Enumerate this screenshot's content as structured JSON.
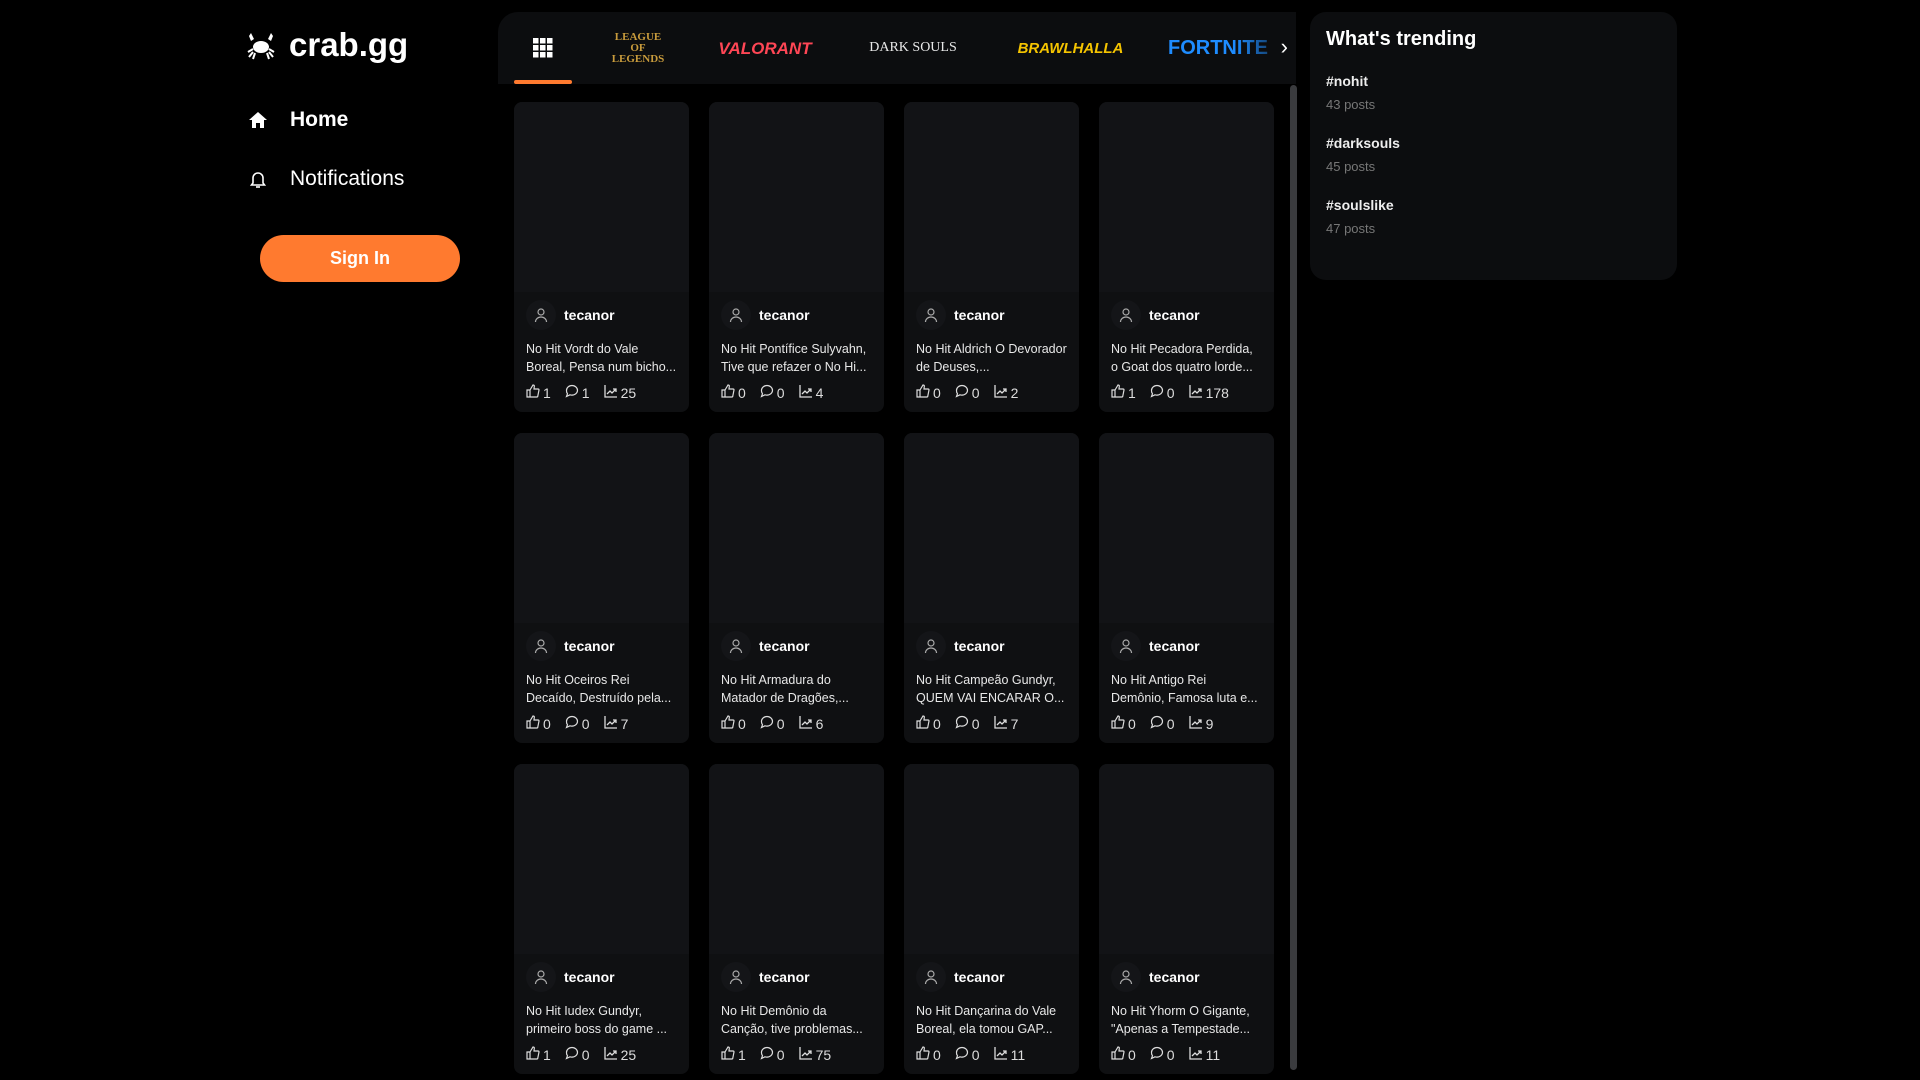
{
  "brand": {
    "name": "crab.gg"
  },
  "nav": [
    {
      "label": "Home",
      "icon": "home-icon"
    },
    {
      "label": "Notifications",
      "icon": "bell-icon"
    }
  ],
  "sign_in": "Sign In",
  "games": [
    {
      "label": "LEAGUE OF LEGENDS",
      "color": "#c89b3c"
    },
    {
      "label": "VALORANT",
      "color": "#ff4655"
    },
    {
      "label": "DARK SOULS",
      "color": "#e8e8e8"
    },
    {
      "label": "BRAWLHALLA",
      "color": "#f5c400"
    },
    {
      "label": "FORTNITE",
      "color": "#1e8cff"
    }
  ],
  "accent": "#ff7a2f",
  "posts": [
    {
      "author": "tecanor",
      "title": "No Hit Vordt do Vale Boreal, Pensa num bicho...",
      "likes": "1",
      "comments": "1",
      "views": "25"
    },
    {
      "author": "tecanor",
      "title": "No Hit Pontífice Sulyvahn, Tive que refazer o No Hi...",
      "likes": "0",
      "comments": "0",
      "views": "4"
    },
    {
      "author": "tecanor",
      "title": "No Hit Aldrich O Devorador de Deuses,...",
      "likes": "0",
      "comments": "0",
      "views": "2"
    },
    {
      "author": "tecanor",
      "title": "No Hit Pecadora Perdida, o Goat dos quatro lorde...",
      "likes": "1",
      "comments": "0",
      "views": "178"
    },
    {
      "author": "tecanor",
      "title": "No Hit Oceiros Rei Decaído, Destruído pela...",
      "likes": "0",
      "comments": "0",
      "views": "7"
    },
    {
      "author": "tecanor",
      "title": "No Hit Armadura do Matador de Dragões,...",
      "likes": "0",
      "comments": "0",
      "views": "6"
    },
    {
      "author": "tecanor",
      "title": "No Hit Campeão Gundyr, QUEM VAI ENCARAR O...",
      "likes": "0",
      "comments": "0",
      "views": "7"
    },
    {
      "author": "tecanor",
      "title": "No Hit Antigo Rei Demônio, Famosa luta e...",
      "likes": "0",
      "comments": "0",
      "views": "9"
    },
    {
      "author": "tecanor",
      "title": "No Hit Iudex Gundyr, primeiro boss do game ...",
      "likes": "1",
      "comments": "0",
      "views": "25"
    },
    {
      "author": "tecanor",
      "title": "No Hit Demônio da Canção, tive problemas...",
      "likes": "1",
      "comments": "0",
      "views": "75"
    },
    {
      "author": "tecanor",
      "title": "No Hit Dançarina do Vale Boreal, ela tomou GAP...",
      "likes": "0",
      "comments": "0",
      "views": "11"
    },
    {
      "author": "tecanor",
      "title": "No Hit Yhorm O Gigante, \"Apenas a Tempestade...",
      "likes": "0",
      "comments": "0",
      "views": "11"
    }
  ],
  "trending": {
    "title": "What's trending",
    "items": [
      {
        "tag": "#nohit",
        "count": "43 posts"
      },
      {
        "tag": "#darksouls",
        "count": "45 posts"
      },
      {
        "tag": "#soulslike",
        "count": "47 posts"
      }
    ]
  }
}
